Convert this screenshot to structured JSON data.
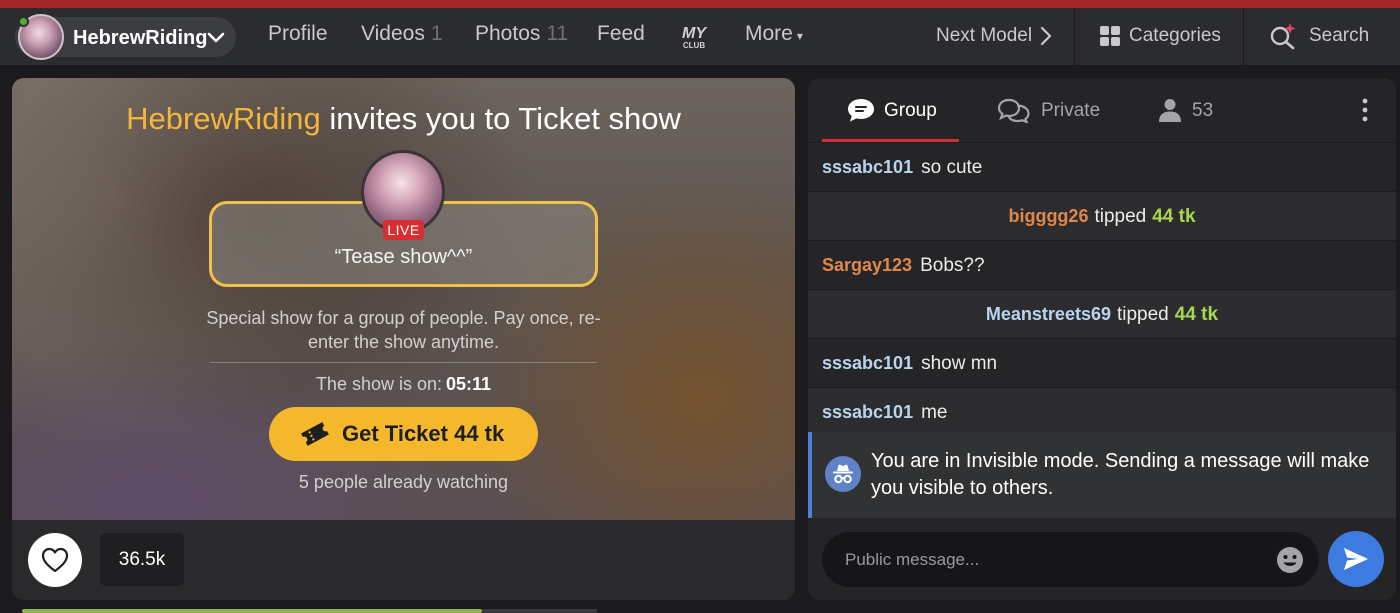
{
  "colors": {
    "accent_red": "#a2252a",
    "brand_yellow": "#f5b82c",
    "model_name_yellow": "#f3b63c",
    "tip_green": "#a6d94f",
    "info_blue": "#4f7fd8",
    "send_blue": "#3e7be0",
    "live_red": "#d62e32"
  },
  "nav": {
    "model_name": "HebrewRiding",
    "profile": "Profile",
    "videos": "Videos",
    "videos_count": "1",
    "photos": "Photos",
    "photos_count": "11",
    "feed": "Feed",
    "club_logo_top": "MY",
    "club_logo_bottom": "CLUB",
    "more": "More",
    "next_model": "Next Model",
    "categories": "Categories",
    "search": "Search"
  },
  "show": {
    "title_model": "HebrewRiding",
    "title_rest": " invites you to Ticket show",
    "live_badge": "LIVE",
    "show_name": "“Tease show^^”",
    "description": "Special show for a group of people. Pay once, re-enter the show anytime.",
    "status_label": "The show is on:",
    "timer": "05:11",
    "ticket_button": "Get Ticket 44 tk",
    "watching": "5 people already watching"
  },
  "player": {
    "likes": "36.5k",
    "progress_fraction": 0.8
  },
  "chat": {
    "tabs": {
      "group": "Group",
      "private": "Private",
      "users_count": "53"
    },
    "messages": [
      {
        "type": "chat",
        "user": "sssabc101",
        "user_color": "#b9d4ef",
        "text": "so cute"
      },
      {
        "type": "tip",
        "user": "bigggg26",
        "user_color": "#e0874a",
        "text": "tipped",
        "amount": "44 tk"
      },
      {
        "type": "chat",
        "user": "Sargay123",
        "user_color": "#e0874a",
        "text": "Bobs??"
      },
      {
        "type": "tip",
        "user": "Meanstreets69",
        "user_color": "#b9d4ef",
        "text": "tipped",
        "amount": "44 tk"
      },
      {
        "type": "chat",
        "user": "sssabc101",
        "user_color": "#b9d4ef",
        "text": "show mn"
      },
      {
        "type": "chat",
        "user": "sssabc101",
        "user_color": "#b9d4ef",
        "text": "me"
      }
    ],
    "invisible_notice": "You are in Invisible mode. Sending a message will make you visible to others.",
    "input_placeholder": "Public message...",
    "input_value": ""
  },
  "icons": {
    "avatar": "avatar",
    "chevron_down": "chevron-down-icon",
    "chevron_right": "chevron-right-icon",
    "categories": "grid-icon",
    "search": "search-sparkle-icon",
    "ticket": "ticket-icon",
    "heart": "heart-icon",
    "group_chat": "chat-bubble-icon",
    "private_chat": "chat-bubbles-icon",
    "users": "user-icon",
    "kebab": "kebab-menu-icon",
    "incognito": "incognito-icon",
    "emoji": "smiley-icon",
    "send": "send-icon"
  }
}
